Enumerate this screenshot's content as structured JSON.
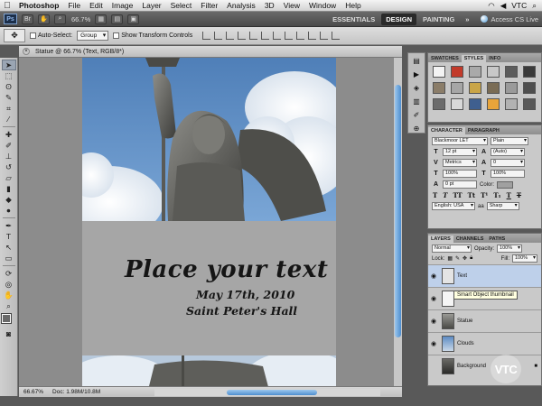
{
  "menubar": {
    "app": "Photoshop",
    "items": [
      "File",
      "Edit",
      "Image",
      "Layer",
      "Select",
      "Filter",
      "Analysis",
      "3D",
      "View",
      "Window",
      "Help"
    ],
    "right_label": "VTC"
  },
  "appbar": {
    "logo": "Ps",
    "zoom": "66.7%",
    "workspaces": [
      "ESSENTIALS",
      "DESIGN",
      "PAINTING"
    ],
    "active_workspace": "DESIGN",
    "more": "»",
    "cs_live": "Access CS Live"
  },
  "options": {
    "auto_select_label": "Auto-Select:",
    "auto_select_value": "Group",
    "transform_label": "Show Transform Controls"
  },
  "document": {
    "tab_title": "Statue @ 66.7% (Text, RGB/8*)",
    "headline": "Place your text",
    "line2": "May 17th, 2010",
    "line3": "Saint Peter's Hall",
    "status_zoom": "66.67%",
    "status_doc": "Doc: 1.98M/10.8M"
  },
  "swatches_panel": {
    "tabs": [
      "SWATCHES",
      "STYLES",
      "INFO"
    ],
    "active_tab": "STYLES",
    "colors": [
      "#f3f3f3",
      "#c23a2a",
      "#a9a9a9",
      "#c8c8c8",
      "#5c5c5c",
      "#3a3a3a",
      "#8b7d69",
      "#a6a6a6",
      "#c9a548",
      "#7a6c55",
      "#9a9a9a",
      "#4f4f4f",
      "#6c6c6c",
      "#d8d8d8",
      "#3f5f8f",
      "#e8a43a",
      "#b2b2b2",
      "#595959"
    ]
  },
  "character_panel": {
    "tabs": [
      "CHARACTER",
      "PARAGRAPH"
    ],
    "font_family": "Blackmoor LET",
    "font_style": "Plain",
    "size": "12 pt",
    "leading": "(Auto)",
    "kerning": "Metrics",
    "tracking": "0",
    "vertical_scale": "100%",
    "horizontal_scale": "100%",
    "baseline": "0 pt",
    "color_label": "Color:",
    "language": "English: USA",
    "aa": "aa",
    "antialias": "Sharp"
  },
  "layers_panel": {
    "tabs": [
      "LAYERS",
      "CHANNELS",
      "PATHS"
    ],
    "blend_mode": "Normal",
    "opacity_label": "Opacity:",
    "opacity": "100%",
    "lock_label": "Lock:",
    "fill_label": "Fill:",
    "fill": "100%",
    "layers": [
      {
        "name": "Text",
        "selected": true
      },
      {
        "name": "",
        "selected": false
      },
      {
        "name": "Statue",
        "selected": false
      },
      {
        "name": "Clouds",
        "selected": false
      },
      {
        "name": "Background",
        "selected": false
      }
    ],
    "tooltip": "Smart Object thumbnail"
  },
  "watermark": "VTC"
}
